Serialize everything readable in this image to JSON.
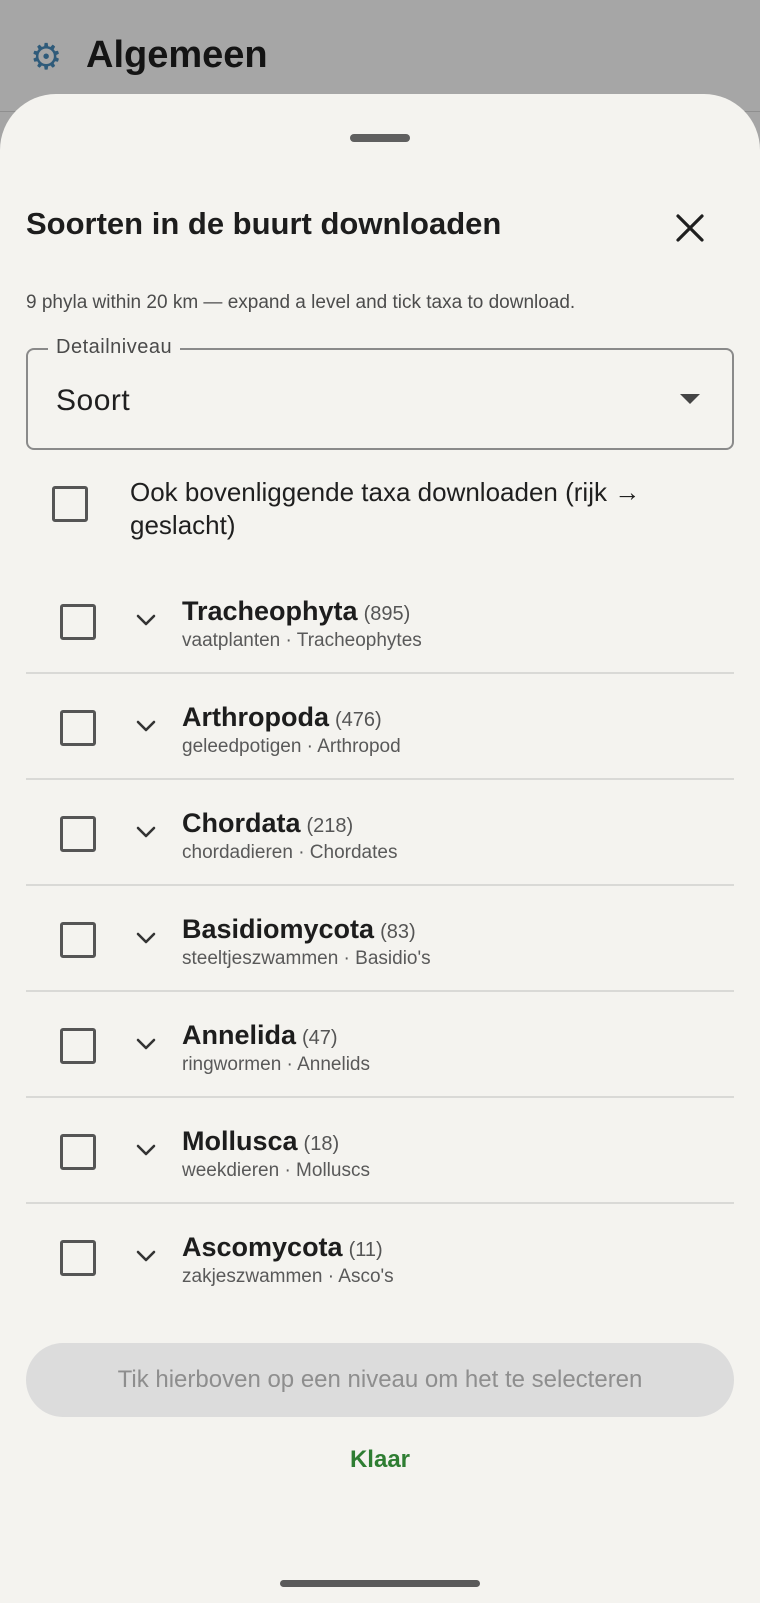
{
  "background": {
    "title": "Algemeen",
    "icon": "gear-icon"
  },
  "sheet": {
    "title": "Soorten in de buurt downloaden",
    "subtitle": "9 phyla within 20 km — expand a level and tick taxa to download.",
    "close_icon": "close-icon"
  },
  "detail_level": {
    "label": "Detailniveau",
    "value": "Soort"
  },
  "ancestors_option": {
    "label": "Ook bovenliggende taxa downloaden (rijk → geslacht)",
    "checked": false
  },
  "taxa": [
    {
      "name": "Tracheophyta",
      "count": "(895)",
      "sub": "vaatplanten · Tracheophytes",
      "checked": false
    },
    {
      "name": "Arthropoda",
      "count": "(476)",
      "sub": "geleedpotigen · Arthropod",
      "checked": false
    },
    {
      "name": "Chordata",
      "count": "(218)",
      "sub": "chordadieren · Chordates",
      "checked": false
    },
    {
      "name": "Basidiomycota",
      "count": "(83)",
      "sub": "steeltjeszwammen · Basidio's",
      "checked": false
    },
    {
      "name": "Annelida",
      "count": "(47)",
      "sub": "ringwormen · Annelids",
      "checked": false
    },
    {
      "name": "Mollusca",
      "count": "(18)",
      "sub": "weekdieren · Molluscs",
      "checked": false
    },
    {
      "name": "Ascomycota",
      "count": "(11)",
      "sub": "zakjeszwammen · Asco's",
      "checked": false
    }
  ],
  "actions": {
    "primary_disabled_label": "Tik hierboven op een niveau om het te selecteren",
    "done_label": "Klaar"
  },
  "colors": {
    "sheet_bg": "#f4f3ef",
    "accent_green": "#2e7d32",
    "scrim": "#a5a5a5"
  }
}
